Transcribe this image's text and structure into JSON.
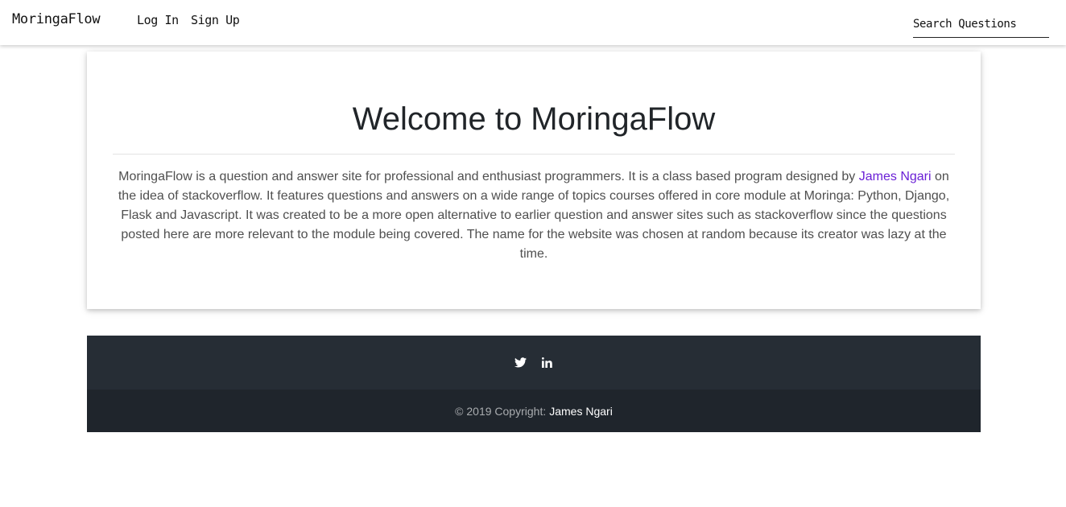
{
  "navbar": {
    "brand": "MoringaFlow",
    "login": "Log In",
    "signup": "Sign Up",
    "search_placeholder": "Search Questions"
  },
  "card": {
    "title": "Welcome to MoringaFlow",
    "text_before": "MoringaFlow is a question and answer site for professional and enthusiast programmers. It is a class based program designed by ",
    "author_link": "James Ngari",
    "text_after": " on the idea of stackoverflow. It features questions and answers on a wide range of topics courses offered in core module at Moringa: Python, Django, Flask and Javascript. It was created to be a more open alternative to earlier question and answer sites such as stackoverflow since the questions posted here are more relevant to the module being covered. The name for the website was chosen at random because its creator was lazy at the time."
  },
  "footer": {
    "icons": [
      "twitter-icon",
      "linkedin-icon"
    ],
    "copyright": "© 2019 Copyright:",
    "author": "James Ngari"
  },
  "colors": {
    "link": "#6a1fd6",
    "footer_top": "#262d35",
    "footer_bottom": "#1f252c"
  }
}
